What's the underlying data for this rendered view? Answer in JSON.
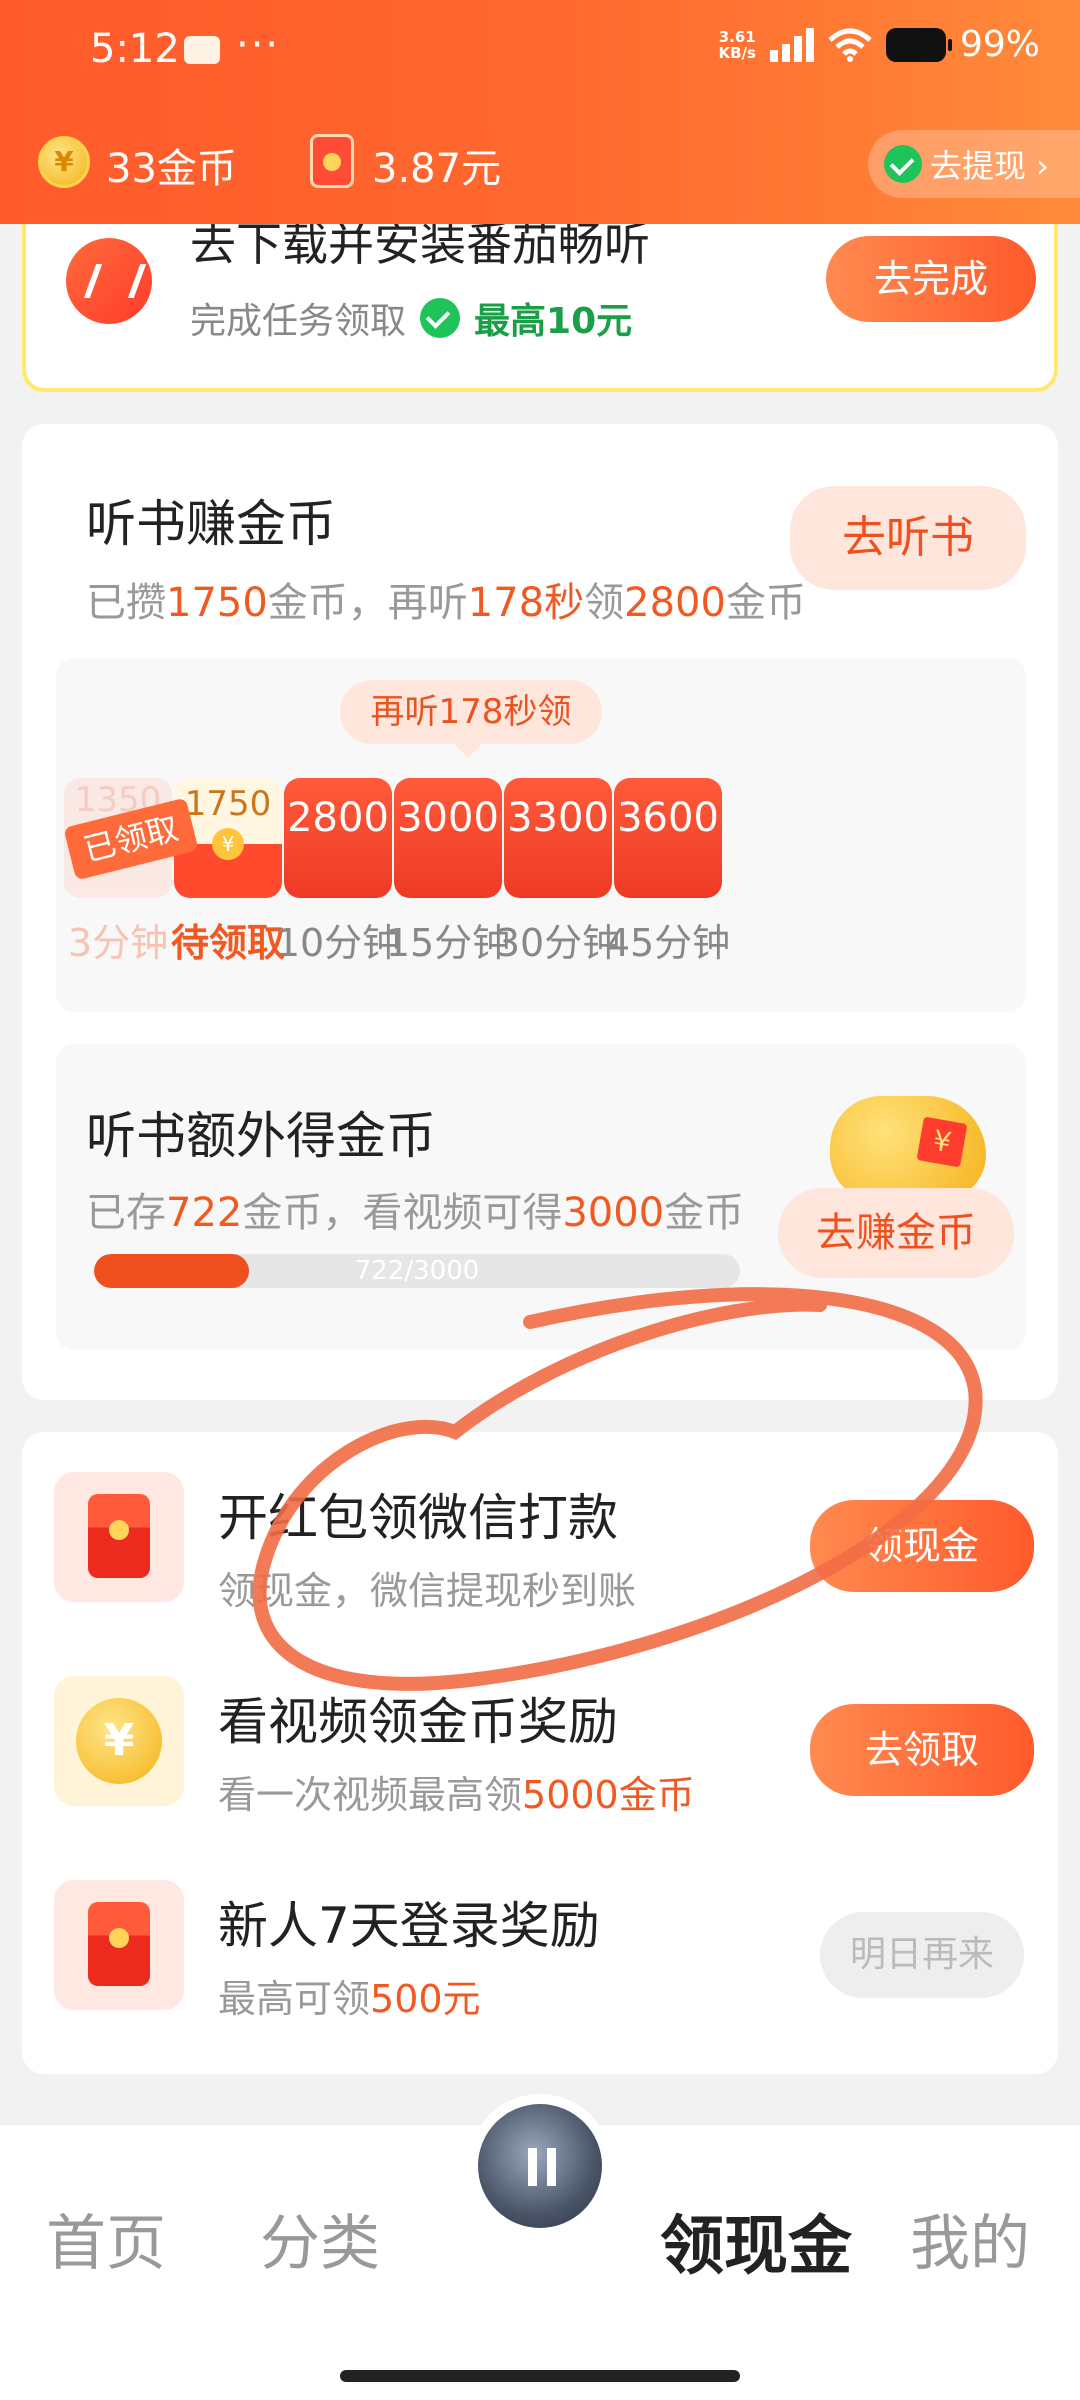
{
  "status_bar": {
    "time": "5:12",
    "dots": "···",
    "net_speed": "3.61\nKB/s",
    "battery": "99%"
  },
  "header": {
    "coins": "33金币",
    "cash": "3.87元",
    "withdraw_label": "去提现 ›"
  },
  "task": {
    "title": "去下载并安装番茄畅听",
    "subtitle": "完成任务领取",
    "max_reward": "最高10元",
    "button": "去完成"
  },
  "listen": {
    "title": "听书赚金币",
    "sub_a": "已攒",
    "sub_coins": "1750",
    "sub_b": "金币，再听",
    "sub_secs": "178秒",
    "sub_c": "领",
    "sub_next": "2800",
    "sub_d": "金币",
    "button": "去听书",
    "tip": "再听178秒领",
    "done_tag": "已领取",
    "rewards": [
      {
        "amount": "1350",
        "label": "3分钟"
      },
      {
        "amount": "1750",
        "label": "待领取"
      },
      {
        "amount": "2800",
        "label": "10分钟"
      },
      {
        "amount": "3000",
        "label": "15分钟"
      },
      {
        "amount": "3300",
        "label": "30分钟"
      },
      {
        "amount": "3600",
        "label": "45分钟"
      }
    ]
  },
  "extra": {
    "title": "听书额外得金币",
    "sub_a": "已存",
    "sub_stored": "722",
    "sub_b": "金币，看视频可得",
    "sub_max": "3000",
    "sub_c": "金币",
    "button": "去赚金币",
    "progress_text": "722/3000",
    "progress_value": 0.2407
  },
  "list": [
    {
      "title": "开红包领微信打款",
      "sub_a": "领现金，微信提现秒到账",
      "sub_hl": "",
      "sub_b": "",
      "button": "领现金"
    },
    {
      "title": "看视频领金币奖励",
      "sub_a": "看一次视频最高领",
      "sub_hl": "5000金币",
      "sub_b": "",
      "button": "去领取"
    },
    {
      "title": "新人7天登录奖励",
      "sub_a": "最高可领",
      "sub_hl": "500元",
      "sub_b": "",
      "button": "明日再来"
    }
  ],
  "tabbar": {
    "home": "首页",
    "category": "分类",
    "cash": "领现金",
    "mine": "我的"
  },
  "colors": {
    "accent": "#ff5a2b",
    "highlight": "#f05a22",
    "wechat_green": "#1ec35a",
    "annotation": "#f26b45"
  }
}
